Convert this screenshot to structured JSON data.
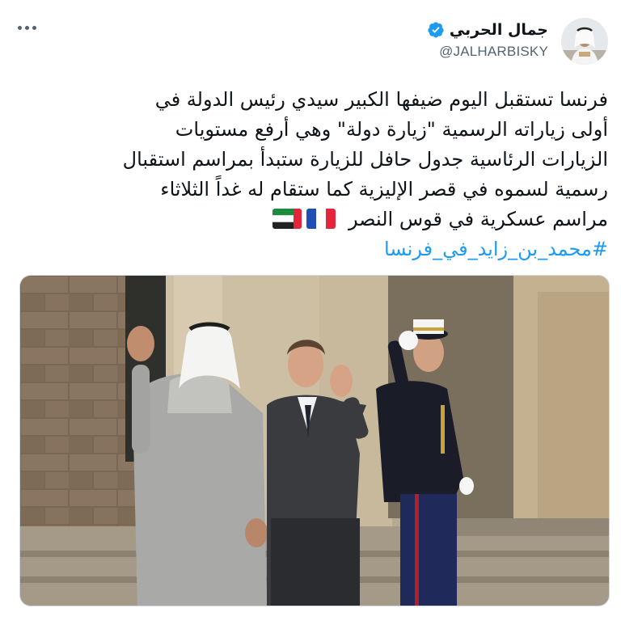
{
  "user": {
    "display_name": "جمال الحربي",
    "handle": "@JALHARBISKY",
    "verified": true
  },
  "tweet": {
    "lines": [
      "فرنسا تستقبل اليوم ضيفها الكبير سيدي رئيس الدولة في",
      "أولى زياراته الرسمية \"زيارة دولة\" وهي أرفع مستويات",
      "الزيارات الرئاسية جدول حافل للزيارة ستبدأ بمراسم استقبال",
      "رسمية لسموه في قصر الإليزية كما ستقام له غداً الثلاثاء",
      "مراسم عسكرية في قوس النصر"
    ],
    "hashtag": "#محمد_بن_زايد_في_فرنسا",
    "flags": [
      "france-flag",
      "uae-flag"
    ]
  },
  "icons": {
    "more": "more-horizontal-icon",
    "verified": "verified-badge-icon"
  },
  "colors": {
    "link": "#1d9bf0",
    "secondary_text": "#536471",
    "primary_text": "#0f1419",
    "background": "#ffffff"
  }
}
